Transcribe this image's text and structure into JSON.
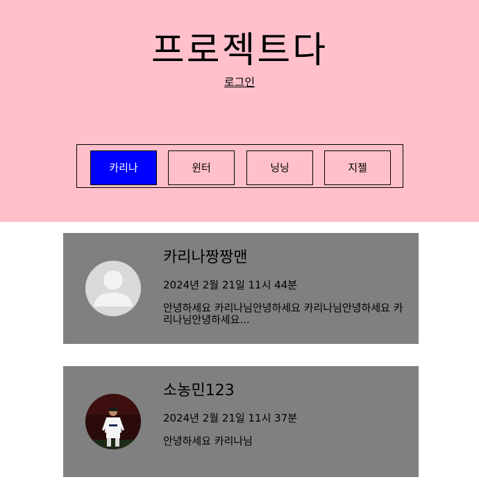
{
  "header": {
    "title": "프로젝트다",
    "login_label": "로그인",
    "background": "#ffc0cb"
  },
  "tabs": [
    {
      "label": "카리나",
      "active": true
    },
    {
      "label": "윈터",
      "active": false
    },
    {
      "label": "닝닝",
      "active": false
    },
    {
      "label": "지젤",
      "active": false
    }
  ],
  "accent_color": "#0000ff",
  "posts": [
    {
      "author": "카리나짱짱맨",
      "date": "2024년 2월 21일 11시 44분",
      "body": "안녕하세요 카리나님안녕하세요 카리나님안녕하세요 카리나님안녕하세요...",
      "avatar": "default-user-icon"
    },
    {
      "author": "소농민123",
      "date": "2024년 2월 21일 11시 37분",
      "body": "안녕하세요 카리나님",
      "avatar": "profile-photo"
    }
  ]
}
